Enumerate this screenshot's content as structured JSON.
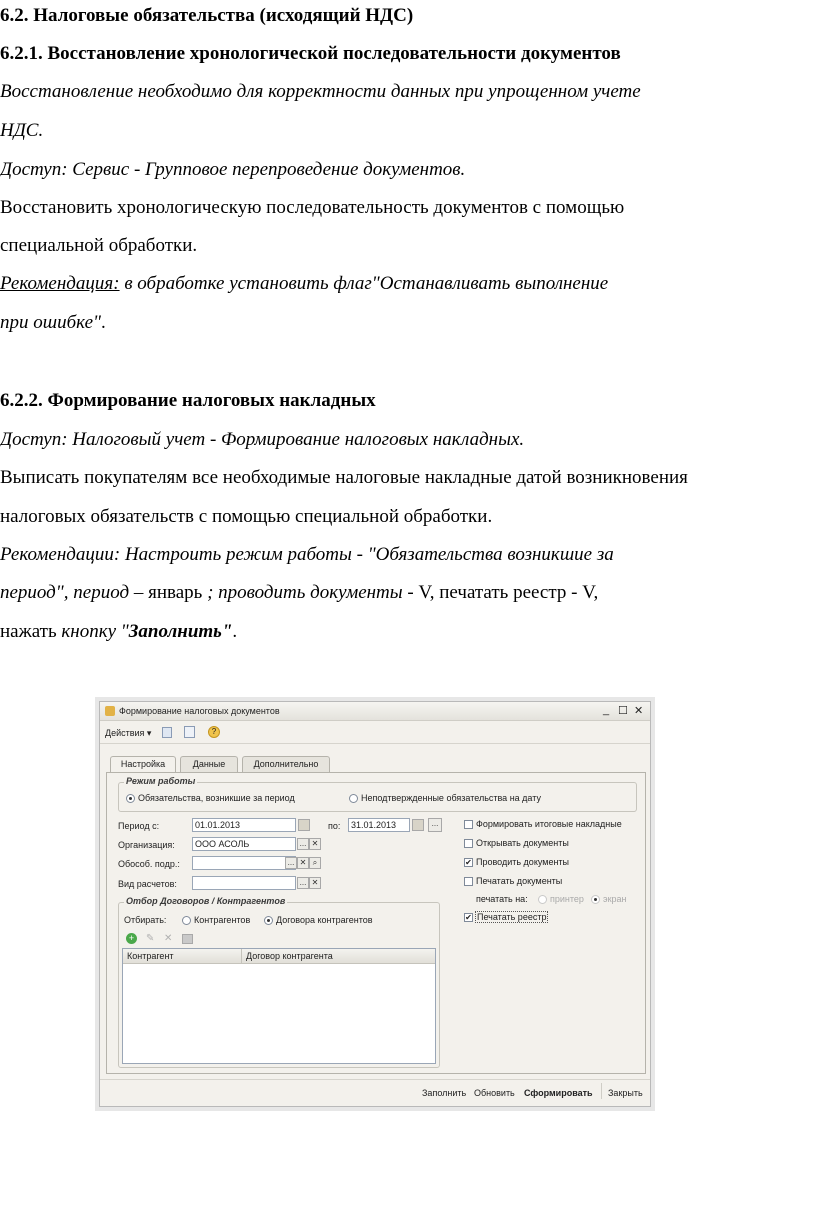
{
  "doc": {
    "h1": "6.2. Налоговые обязательства (исходящий НДС)",
    "h2": "6.2.1. Восстановление хронологической последовательности документов",
    "p1_l1": "Восстановление необходимо для корректности данных при упрощенном учете",
    "p1_l2": "НДС.",
    "access1": "Доступ: Сервис - Групповое перепроведение документов.",
    "p2_l1": "Восстановить хронологическую последовательность документов с помощью",
    "p2_l2": "специальной обработки.",
    "rec1_label": "Рекомендация:",
    "rec1_l1": " в обработке установить флаг\"Останавливать выполнение",
    "rec1_l2": "при ошибке\"",
    "rec1_end": ".",
    "h3": "6.2.2. Формирование налоговых накладных",
    "access2": "Доступ: Налоговый учет - Формирование налоговых накладных.",
    "p3_l1": "Выписать покупателям все необходимые налоговые накладные датой возникновения",
    "p3_l2": "налоговых обязательств с помощью специальной обработки.",
    "rec2_l1": "Рекомендации: Настроить режим работы - \"Обязательства возникшие за",
    "rec2_l2a": "период\", период",
    "rec2_l2b": " – январь ",
    "rec2_l2c": "; проводить документы",
    "rec2_l2d": " - V, печатать реестр - V,",
    "rec2_l3a": "нажать ",
    "rec2_l3b": "кнопку \"",
    "rec2_l3c": "Заполнить\"",
    "rec2_l3d": "."
  },
  "window": {
    "title": "Формирование налоговых документов",
    "controls": [
      "_",
      "☐",
      "✕"
    ],
    "menu_actions": "Действия ▾",
    "tabs": [
      "Настройка",
      "Данные",
      "Дополнительно"
    ],
    "mode_group": "Режим работы",
    "mode_opt1": "Обязательства, возникшие за период",
    "mode_opt2": "Неподтвержденные обязательства на дату",
    "period_label": "Период с:",
    "period_from": "01.01.2013",
    "period_to_label": "по:",
    "period_to": "31.01.2013",
    "org_label": "Организация:",
    "org_value": "ООО АСОЛЬ",
    "subdiv_label": "Обособ. подр.:",
    "calc_label": "Вид расчетов:",
    "chk1": "Формировать итоговые накладные",
    "chk2": "Открывать документы",
    "chk3": "Проводить документы",
    "chk4": "Печатать документы",
    "print_on": "печатать на:",
    "print_printer": "принтер",
    "print_screen": "экран",
    "chk5": "Печатать реестр",
    "filter_group": "Отбор Договоров / Контрагентов",
    "filter_label": "Отбирать:",
    "filter_opt1": "Контрагентов",
    "filter_opt2": "Договора контрагентов",
    "col1": "Контрагент",
    "col2": "Договор контрагента",
    "btn_fill": "Заполнить",
    "btn_refresh": "Обновить",
    "btn_form": "Сформировать",
    "btn_close": "Закрыть",
    "ellipsis": "...",
    "x": "✕",
    "q": "?",
    "check": "✔"
  }
}
